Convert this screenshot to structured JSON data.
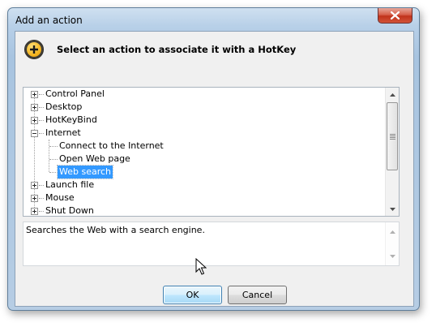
{
  "window": {
    "title": "Add an action",
    "close_icon": "close-x-icon"
  },
  "header": {
    "icon": "add-circle-icon",
    "text": "Select an action to associate it with a HotKey"
  },
  "tree": {
    "items": [
      {
        "label": "Control Panel",
        "expanded": false
      },
      {
        "label": "Desktop",
        "expanded": false
      },
      {
        "label": "HotKeyBind",
        "expanded": false
      },
      {
        "label": "Internet",
        "expanded": true
      },
      {
        "label": "Connect to the Internet",
        "child": true
      },
      {
        "label": "Open Web page",
        "child": true
      },
      {
        "label": "Web search",
        "child": true,
        "selected": true
      },
      {
        "label": "Launch file",
        "expanded": false
      },
      {
        "label": "Mouse",
        "expanded": false
      },
      {
        "label": "Shut Down",
        "expanded": false
      }
    ]
  },
  "description": {
    "text": "Searches the Web with a search engine."
  },
  "buttons": {
    "ok": "OK",
    "cancel": "Cancel"
  },
  "colors": {
    "selection": "#3399ff",
    "close_button": "#c0321b",
    "frame": "#b8d0e8"
  }
}
